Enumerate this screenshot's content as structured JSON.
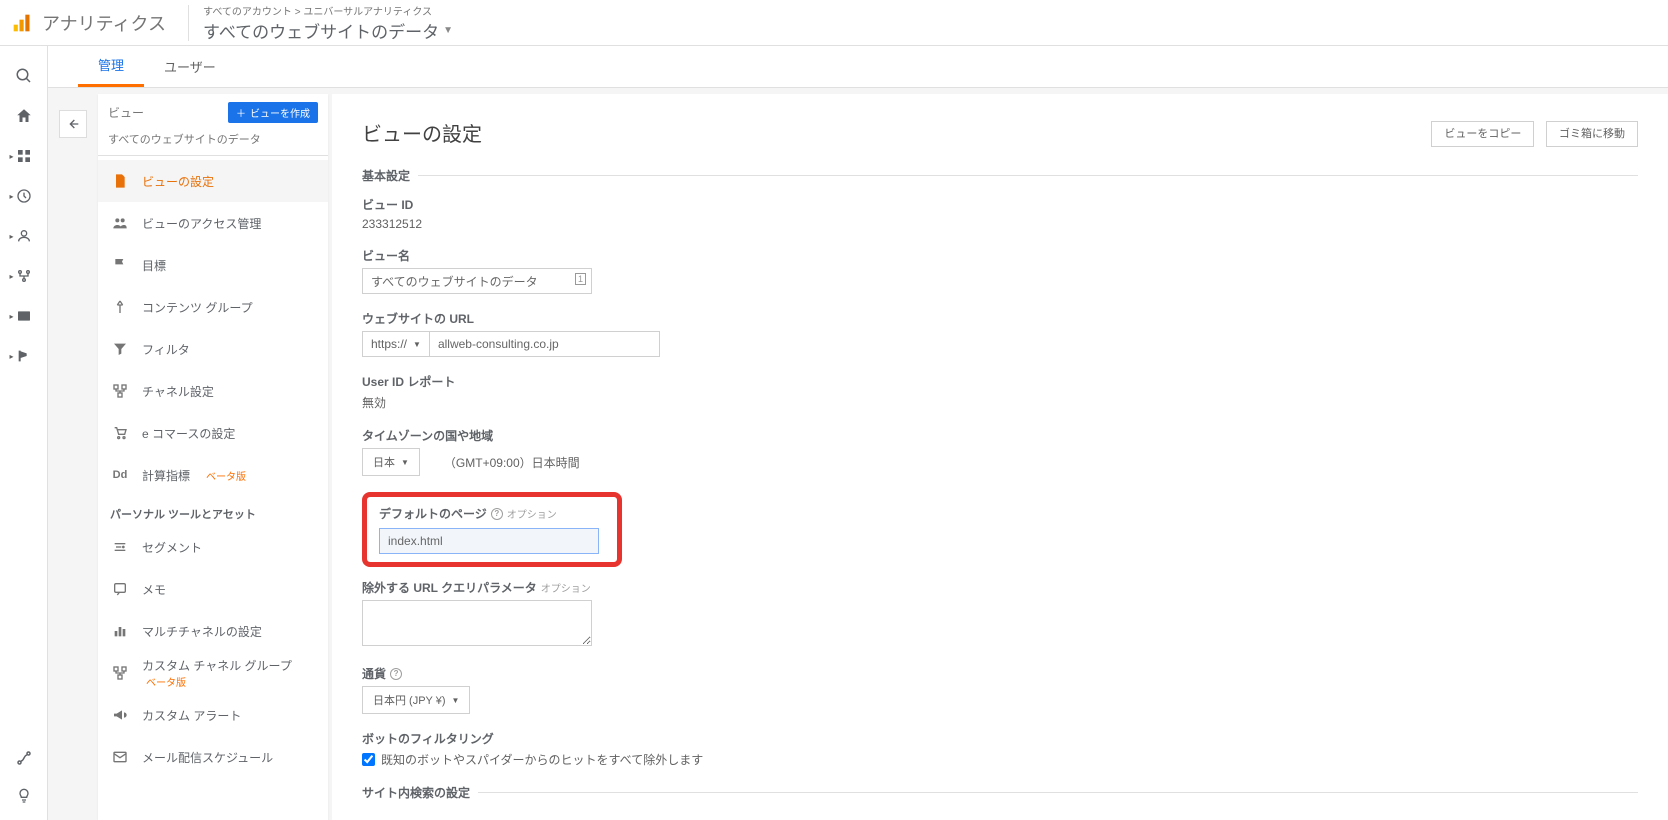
{
  "header": {
    "product": "アナリティクス",
    "breadcrumb_top": "すべてのアカウント > ユニバーサルアナリティクス",
    "breadcrumb_main": "すべてのウェブサイトのデータ"
  },
  "tabs": {
    "admin": "管理",
    "user": "ユーザー"
  },
  "column": {
    "label": "ビュー",
    "create": "ビューを作成",
    "subtitle": "すべてのウェブサイトのデータ",
    "items": [
      "ビューの設定",
      "ビューのアクセス管理",
      "目標",
      "コンテンツ グループ",
      "フィルタ",
      "チャネル設定",
      "e コマースの設定",
      "計算指標"
    ],
    "beta": "ベータ版",
    "section2": "パーソナル ツールとアセット",
    "items2": [
      "セグメント",
      "メモ",
      "マルチチャネルの設定",
      "カスタム チャネル グループ",
      "カスタム アラート",
      "メール配信スケジュール"
    ]
  },
  "settings": {
    "title": "ビューの設定",
    "copy_btn": "ビューをコピー",
    "trash_btn": "ゴミ箱に移動",
    "section_basic": "基本設定",
    "view_id_label": "ビュー ID",
    "view_id": "233312512",
    "view_name_label": "ビュー名",
    "view_name": "すべてのウェブサイトのデータ",
    "url_label": "ウェブサイトの URL",
    "proto": "https://",
    "url": "allweb-consulting.co.jp",
    "user_id_label": "User ID レポート",
    "user_id_value": "無効",
    "tz_label": "タイムゾーンの国や地域",
    "tz_country": "日本",
    "tz_offset": "（GMT+09:00）日本時間",
    "default_page_label": "デフォルトのページ",
    "optional": "オプション",
    "default_page": "index.html",
    "exclude_label": "除外する URL クエリパラメータ",
    "currency_label": "通貨",
    "currency": "日本円 (JPY ¥)",
    "bot_label": "ボットのフィルタリング",
    "bot_check": "既知のボットやスパイダーからのヒットをすべて除外します",
    "site_search": "サイト内検索の設定"
  }
}
